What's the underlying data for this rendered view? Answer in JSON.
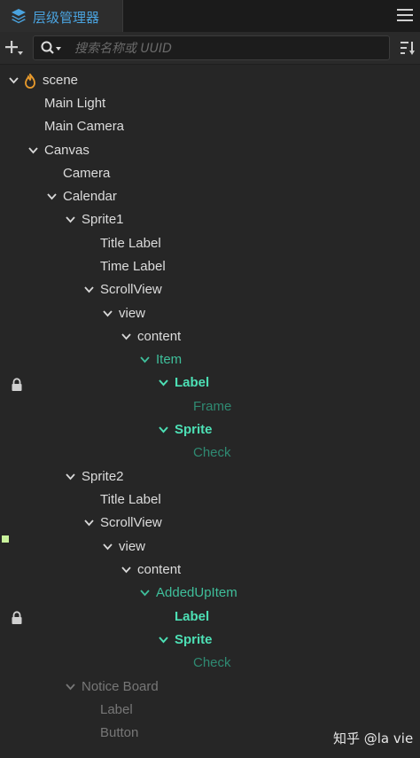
{
  "panel": {
    "tab_title": "层级管理器",
    "search_placeholder": "搜索名称或 UUID"
  },
  "tree": [
    {
      "label": "scene",
      "expanded": true,
      "color": "white"
    },
    {
      "label": "Main Light",
      "expanded": null,
      "color": "white"
    },
    {
      "label": "Main Camera",
      "expanded": null,
      "color": "white"
    },
    {
      "label": "Canvas",
      "expanded": true,
      "color": "white"
    },
    {
      "label": "Camera",
      "expanded": null,
      "color": "white"
    },
    {
      "label": "Calendar",
      "expanded": true,
      "color": "white"
    },
    {
      "label": "Sprite1",
      "expanded": true,
      "color": "white"
    },
    {
      "label": "Title Label",
      "expanded": null,
      "color": "white"
    },
    {
      "label": "Time Label",
      "expanded": null,
      "color": "white"
    },
    {
      "label": "ScrollView",
      "expanded": true,
      "color": "white"
    },
    {
      "label": "view",
      "expanded": true,
      "color": "white"
    },
    {
      "label": "content",
      "expanded": true,
      "color": "white"
    },
    {
      "label": "Item",
      "expanded": true,
      "color": "teal",
      "locked": true
    },
    {
      "label": "Label",
      "expanded": true,
      "color": "bright-teal"
    },
    {
      "label": "Frame",
      "expanded": null,
      "color": "dark-teal"
    },
    {
      "label": "Sprite",
      "expanded": true,
      "color": "bright-teal"
    },
    {
      "label": "Check",
      "expanded": null,
      "color": "dark-teal"
    },
    {
      "label": "Sprite2",
      "expanded": true,
      "color": "white"
    },
    {
      "label": "Title Label",
      "expanded": null,
      "color": "white"
    },
    {
      "label": "ScrollView",
      "expanded": true,
      "color": "white"
    },
    {
      "label": "view",
      "expanded": true,
      "color": "white"
    },
    {
      "label": "content",
      "expanded": true,
      "color": "white"
    },
    {
      "label": "AddedUpItem",
      "expanded": true,
      "color": "teal",
      "locked": true
    },
    {
      "label": "Label",
      "expanded": null,
      "color": "bright-teal"
    },
    {
      "label": "Sprite",
      "expanded": true,
      "color": "bright-teal"
    },
    {
      "label": "Check",
      "expanded": null,
      "color": "dark-teal"
    },
    {
      "label": "Notice Board",
      "expanded": true,
      "color": "grey"
    },
    {
      "label": "Label",
      "expanded": null,
      "color": "grey"
    },
    {
      "label": "Button",
      "expanded": null,
      "color": "grey"
    }
  ],
  "watermark": "知乎 @la vie",
  "colors": {
    "accent": "#4aa3df",
    "teal": "#3fbf9b",
    "bright_teal": "#4de0b5",
    "dark_teal": "#2f8a72",
    "scene_icon": "#e89a2c"
  }
}
